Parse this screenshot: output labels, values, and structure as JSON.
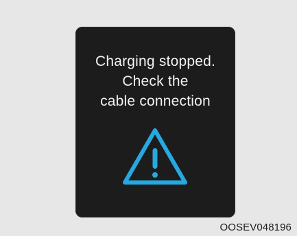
{
  "screen": {
    "message_lines": [
      "Charging stopped.",
      "Check the",
      "cable connection"
    ],
    "icon": "warning-triangle-icon",
    "icon_color": "#26a9e0",
    "background_color": "#1c1c1c",
    "text_color": "#f1f1f1"
  },
  "figure_code": "OOSEV048196"
}
